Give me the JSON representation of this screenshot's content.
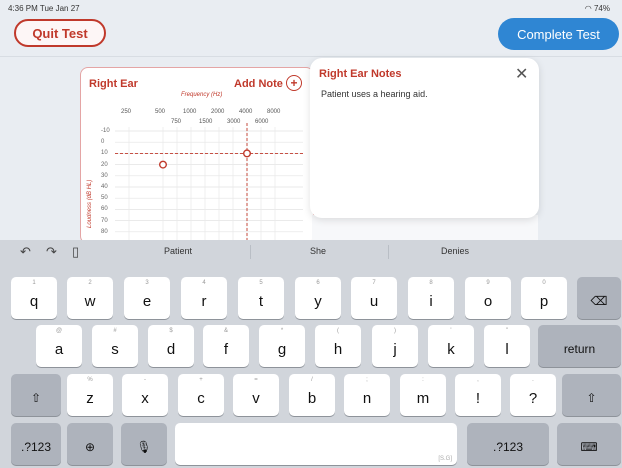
{
  "status": {
    "time": "4:36 PM  Tue Jan 27",
    "battery": "74%"
  },
  "header": {
    "quit_label": "Quit Test",
    "complete_label": "Complete Test"
  },
  "audiogram": {
    "ear_title": "Right Ear",
    "add_note_label": "Add Note",
    "frequency_label": "Frequency (Hz)",
    "freq_row1": [
      "250",
      "500",
      "1000",
      "2000",
      "4000",
      "8000"
    ],
    "freq_row2": [
      "750",
      "1500",
      "3000",
      "6000"
    ],
    "y_ticks": [
      "-10",
      "0",
      "10",
      "20",
      "30",
      "40",
      "50",
      "60",
      "70",
      "80"
    ],
    "y_axis_label": "Loudness (dB HL)",
    "points": [
      {
        "freq": "500",
        "db": 20
      },
      {
        "freq": "4000",
        "db": 10
      }
    ],
    "accent": "#c0392b"
  },
  "notes_popup": {
    "title": "Right Ear Notes",
    "body": "Patient uses a hearing aid.",
    "close_icon": "close-icon"
  },
  "keyboard": {
    "suggestions": [
      "Patient",
      "She",
      "Denies"
    ],
    "row1": [
      {
        "k": "q",
        "h": "1"
      },
      {
        "k": "w",
        "h": "2"
      },
      {
        "k": "e",
        "h": "3"
      },
      {
        "k": "r",
        "h": "4"
      },
      {
        "k": "t",
        "h": "5"
      },
      {
        "k": "y",
        "h": "6"
      },
      {
        "k": "u",
        "h": "7"
      },
      {
        "k": "i",
        "h": "8"
      },
      {
        "k": "o",
        "h": "9"
      },
      {
        "k": "p",
        "h": "0"
      }
    ],
    "row2": [
      {
        "k": "a",
        "h": "@"
      },
      {
        "k": "s",
        "h": "#"
      },
      {
        "k": "d",
        "h": "$"
      },
      {
        "k": "f",
        "h": "&"
      },
      {
        "k": "g",
        "h": "*"
      },
      {
        "k": "h",
        "h": "("
      },
      {
        "k": "j",
        "h": ")"
      },
      {
        "k": "k",
        "h": "'"
      },
      {
        "k": "l",
        "h": "\""
      }
    ],
    "row3": [
      {
        "k": "z",
        "h": "%"
      },
      {
        "k": "x",
        "h": "-"
      },
      {
        "k": "c",
        "h": "+"
      },
      {
        "k": "v",
        "h": "="
      },
      {
        "k": "b",
        "h": "/"
      },
      {
        "k": "n",
        "h": ";"
      },
      {
        "k": "m",
        "h": ":"
      },
      {
        "k": "!",
        "h": ","
      },
      {
        "k": "?",
        "h": "."
      }
    ],
    "return_label": "return",
    "numbers_label": ".?123",
    "space_caption": "[S.G]"
  }
}
